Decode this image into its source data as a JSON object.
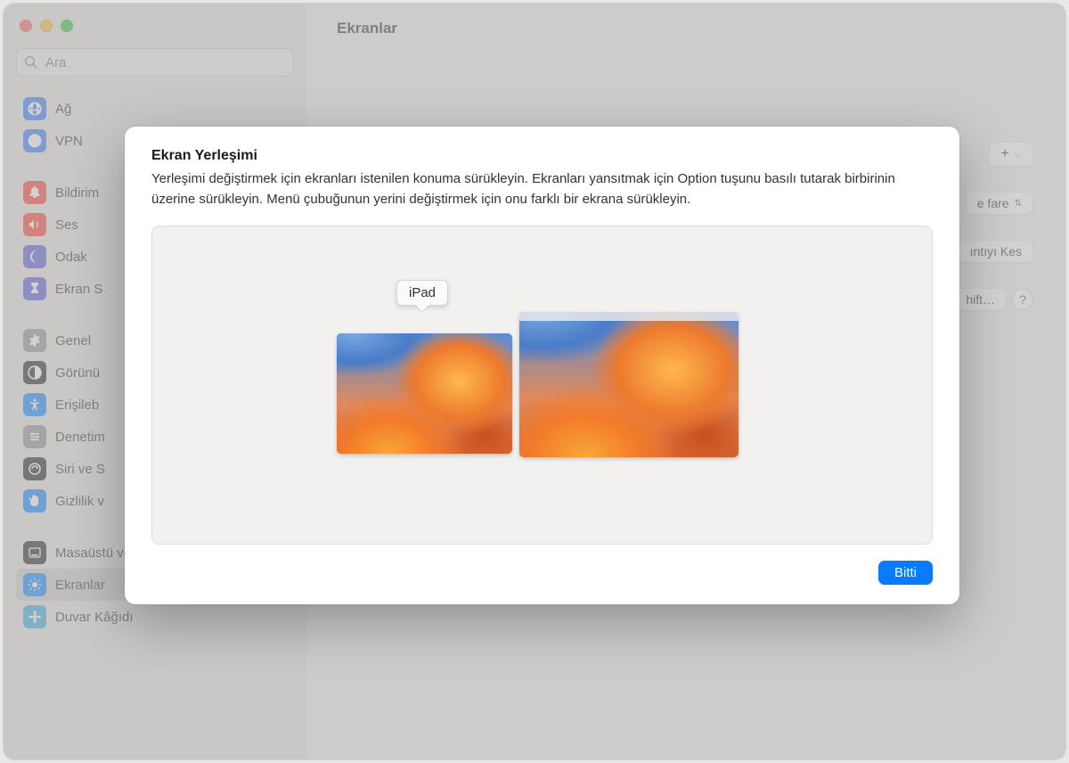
{
  "window": {
    "title": "Ekranlar"
  },
  "search": {
    "placeholder": "Ara"
  },
  "sidebar": {
    "groups": [
      [
        {
          "label": "Ağ",
          "icon": "globe",
          "color": "#3478f6"
        },
        {
          "label": "VPN",
          "icon": "globe-lock",
          "color": "#3478f6"
        }
      ],
      [
        {
          "label": "Bildirim",
          "icon": "bell",
          "color": "#ff3b30"
        },
        {
          "label": "Ses",
          "icon": "sound",
          "color": "#ff3b30"
        },
        {
          "label": "Odak",
          "icon": "moon",
          "color": "#5856d6"
        },
        {
          "label": "Ekran S",
          "icon": "hourglass",
          "color": "#5856d6"
        }
      ],
      [
        {
          "label": "Genel",
          "icon": "gear",
          "color": "#8e8e93"
        },
        {
          "label": "Görünü",
          "icon": "appearance",
          "color": "#1c1c1e"
        },
        {
          "label": "Erişileb",
          "icon": "accessibility",
          "color": "#0a84ff"
        },
        {
          "label": "Denetim",
          "icon": "sliders",
          "color": "#8e8e93"
        },
        {
          "label": "Siri ve S",
          "icon": "siri",
          "color": "#1c1c1e"
        },
        {
          "label": "Gizlilik v",
          "icon": "hand",
          "color": "#0a84ff"
        }
      ],
      [
        {
          "label": "Masaüstü ve Dock",
          "icon": "dock",
          "color": "#1c1c1e"
        },
        {
          "label": "Ekranlar",
          "icon": "brightness",
          "color": "#0a84ff",
          "selected": true
        },
        {
          "label": "Duvar Kâğıdı",
          "icon": "flower",
          "color": "#34aadc"
        }
      ]
    ]
  },
  "background": {
    "plus": "+",
    "fare_label": "e fare",
    "kes_label": "ıntıyı Kes",
    "shift_label": "hift…",
    "help": "?"
  },
  "modal": {
    "title": "Ekran Yerleşimi",
    "description": "Yerleşimi değiştirmek için ekranları istenilen konuma sürükleyin. Ekranları yansıtmak için Option tuşunu basılı tutarak birbirinin üzerine sürükleyin. Menü çubuğunun yerini değiştirmek için onu farklı bir ekrana sürükleyin.",
    "tooltip": "iPad",
    "done": "Bitti"
  }
}
